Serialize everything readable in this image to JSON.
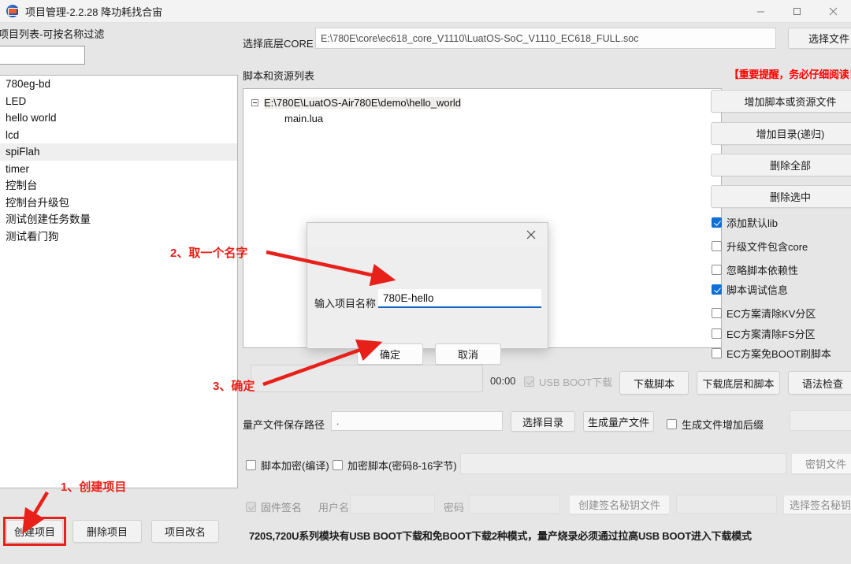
{
  "window": {
    "title": "项目管理-2.2.28 降功耗找合宙",
    "minimize": "−",
    "maximize": "□",
    "close": "✕"
  },
  "left_panel": {
    "list_label": "项目列表-可按名称过滤",
    "filter_value": "",
    "projects": [
      {
        "name": "780eg-bd",
        "selected": false
      },
      {
        "name": "LED",
        "selected": false
      },
      {
        "name": "hello world",
        "selected": false
      },
      {
        "name": "lcd",
        "selected": false
      },
      {
        "name": "spiFlah",
        "selected": true
      },
      {
        "name": "timer",
        "selected": false
      },
      {
        "name": "控制台",
        "selected": false
      },
      {
        "name": "控制台升级包",
        "selected": false
      },
      {
        "name": "测试创建任务数量",
        "selected": false
      },
      {
        "name": "测试看门狗",
        "selected": false
      }
    ],
    "buttons": {
      "create": "创建项目",
      "delete": "删除项目",
      "rename": "项目改名"
    }
  },
  "core_row": {
    "label": "选择底层CORE",
    "path": "E:\\780E\\core\\ec618_core_V1110\\LuatOS-SoC_V1110_EC618_FULL.soc",
    "choose_file": "选择文件"
  },
  "resource_section": {
    "label": "脚本和资源列表",
    "warning": "【重要提醒，务必仔细阅读！】",
    "tree": {
      "root": "E:\\780E\\LuatOS-Air780E\\demo\\hello_world",
      "children": [
        "main.lua"
      ]
    },
    "buttons": [
      "增加脚本或资源文件",
      "增加目录(递归)",
      "删除全部",
      "删除选中"
    ],
    "checkboxes": [
      {
        "label": "添加默认lib",
        "checked": true
      },
      {
        "label": "升级文件包含core",
        "checked": false
      },
      {
        "label": "忽略脚本依赖性",
        "checked": false
      },
      {
        "label": "脚本调试信息",
        "checked": true
      },
      {
        "label": "EC方案清除KV分区",
        "checked": false
      },
      {
        "label": "EC方案清除FS分区",
        "checked": false
      },
      {
        "label": "EC方案免BOOT刷脚本",
        "checked": false
      }
    ]
  },
  "download_row": {
    "timer": "00:00",
    "usb_boot_label": "USB BOOT下载",
    "usb_boot_checked": true,
    "buttons": [
      "下载脚本",
      "下载底层和脚本",
      "语法检查"
    ]
  },
  "mass_production_row": {
    "label": "量产文件保存路径",
    "path_value": ".",
    "choose_dir": "选择目录",
    "generate": "生成量产文件",
    "suffix_label": "生成文件增加后缀",
    "suffix_checked": false
  },
  "encryption_row": {
    "script_encrypt_label": "脚本加密(编译)",
    "script_encrypt_checked": false,
    "encrypt_script_label": "加密脚本(密码8-16字节)",
    "encrypt_script_checked": false,
    "password_value": "",
    "key_file_button": "密钥文件"
  },
  "signature_row": {
    "firmware_sign_label": "固件签名",
    "firmware_sign_checked": false,
    "username_label": "用户名",
    "username_value": "",
    "password_label": "密码",
    "password_value": "",
    "create_key_button": "创建签名秘钥文件",
    "key_path_value": "",
    "select_key_button": "选择签名秘钥文件"
  },
  "footer_note": "720S,720U系列模块有USB BOOT下载和免BOOT下载2种模式，量产烧录必须通过拉高USB BOOT进入下载模式",
  "dialog": {
    "label": "输入项目名称",
    "input_value": "780E-hello",
    "ok": "确定",
    "cancel": "取消",
    "close": "✕"
  },
  "annotations": [
    {
      "id": 1,
      "text": "1、创建项目"
    },
    {
      "id": 2,
      "text": "2、取一个名字"
    },
    {
      "id": 3,
      "text": "3、确定"
    }
  ],
  "colors": {
    "accent": "#0f6fd4",
    "annotation_red": "#e8201a",
    "warning_red": "#ff0000",
    "dialog_underline": "#1565c0"
  }
}
